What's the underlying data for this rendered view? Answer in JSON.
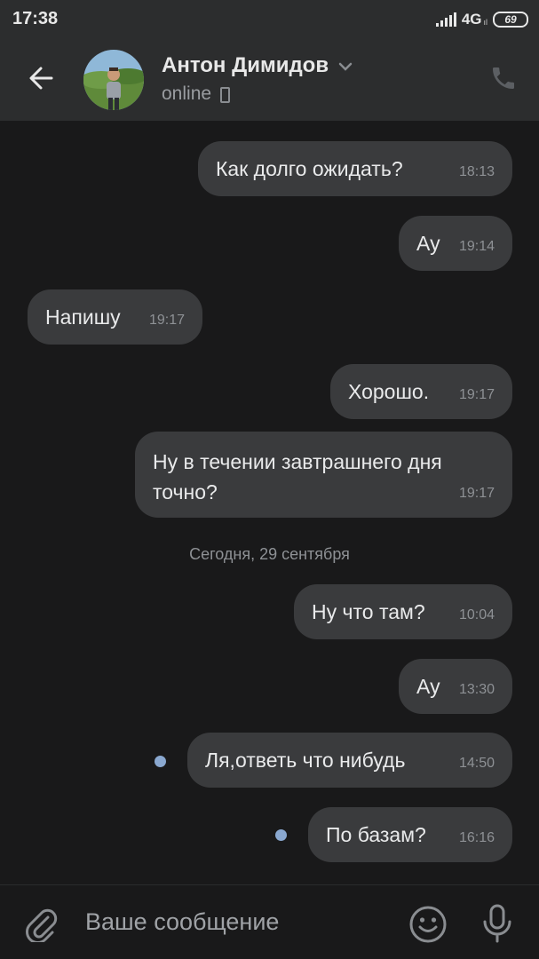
{
  "status_bar": {
    "time": "17:38",
    "network": "4G",
    "network_sub": "ıl",
    "battery": "69"
  },
  "header": {
    "back_icon": "arrow-left-icon",
    "contact_name": "Антон Димидов",
    "status": "online",
    "call_icon": "phone-icon"
  },
  "messages": [
    {
      "text": "Как долго ожидать?",
      "time": "18:13",
      "side": "out"
    },
    {
      "text": "Ау",
      "time": "19:14",
      "side": "out"
    },
    {
      "text": "Напишу",
      "time": "19:17",
      "side": "in"
    },
    {
      "text": "Хорошо.",
      "time": "19:17",
      "side": "out"
    },
    {
      "text": "Ну в течении завтрашнего дня точно?",
      "time": "19:17",
      "side": "out"
    },
    {
      "text": "Ну что там?",
      "time": "10:04",
      "side": "out"
    },
    {
      "text": "Ау",
      "time": "13:30",
      "side": "out"
    },
    {
      "text": "Ля,ответь что нибудь",
      "time": "14:50",
      "side": "out",
      "unread": true
    },
    {
      "text": "По базам?",
      "time": "16:16",
      "side": "out",
      "unread": true
    }
  ],
  "date_separator": "Сегодня, 29 сентября",
  "composer": {
    "placeholder": "Ваше сообщение",
    "attach_icon": "paperclip-icon",
    "emoji_icon": "smile-icon",
    "mic_icon": "microphone-icon"
  },
  "colors": {
    "background": "#19191a",
    "header": "#2c2d2e",
    "bubble": "#3a3b3d",
    "unread_dot": "#8aa8d0"
  }
}
